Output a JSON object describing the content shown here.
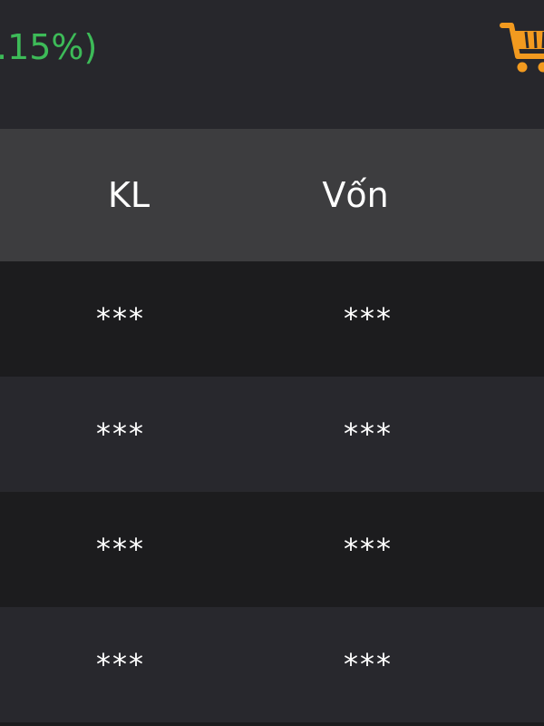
{
  "header": {
    "change_percent": ".15%)",
    "change_color": "#3dbb58",
    "cart_icon": "cart-icon",
    "cart_color": "#f29a1f"
  },
  "table": {
    "columns": [
      "KL",
      "Vốn"
    ],
    "rows": [
      [
        "***",
        "***"
      ],
      [
        "***",
        "***"
      ],
      [
        "***",
        "***"
      ],
      [
        "***",
        "***"
      ]
    ]
  }
}
